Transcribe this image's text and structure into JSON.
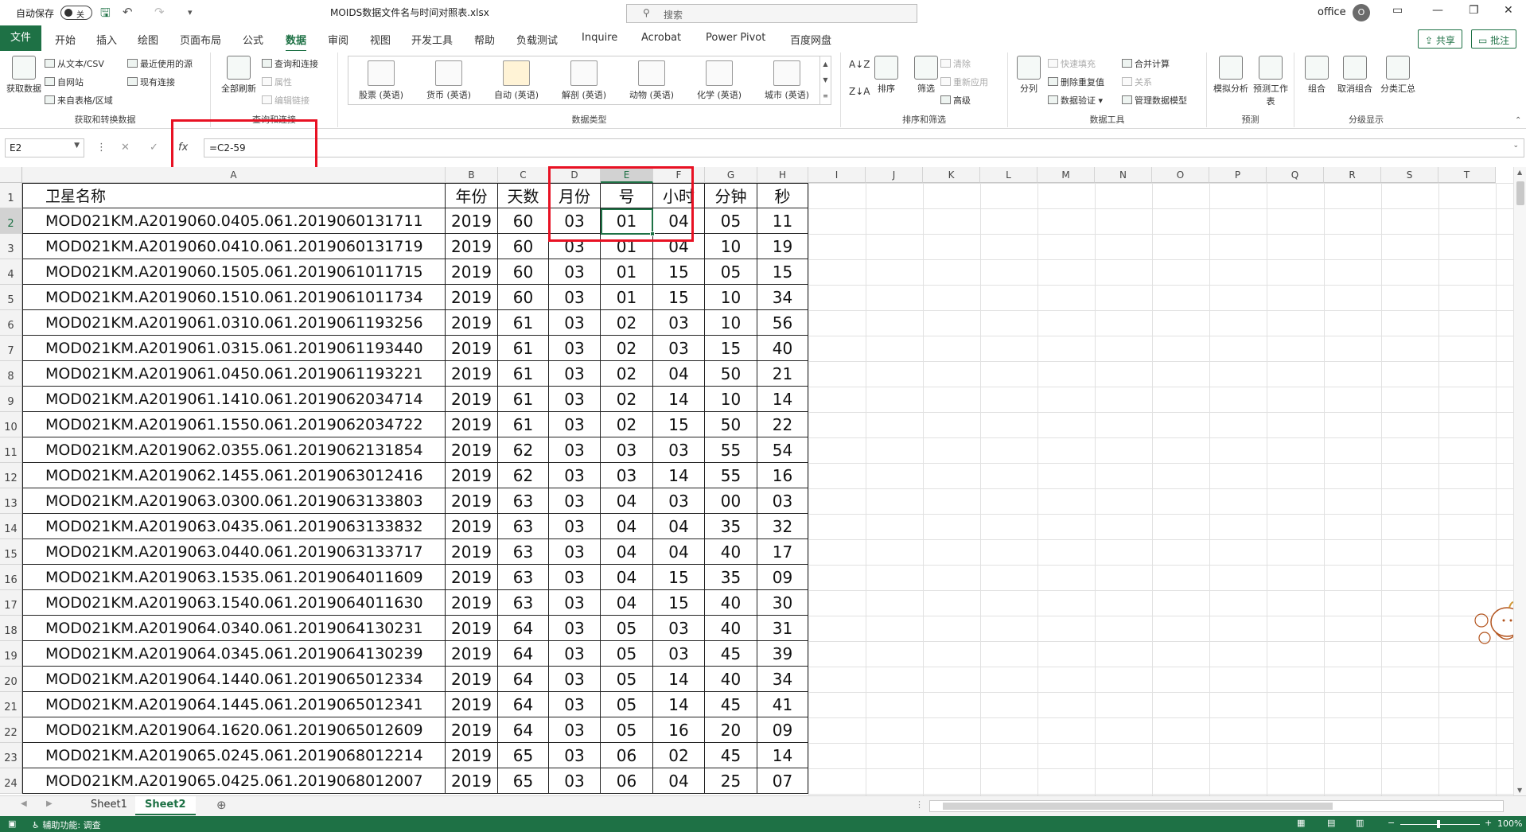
{
  "titlebar": {
    "autosave_label": "自动保存",
    "autosave_state": "关",
    "filename": "MOIDS数据文件名与时间对照表.xlsx",
    "search_placeholder": "搜索",
    "user_name": "office",
    "avatar_initial": "O"
  },
  "tabs": [
    "文件",
    "开始",
    "插入",
    "绘图",
    "页面布局",
    "公式",
    "数据",
    "审阅",
    "视图",
    "开发工具",
    "帮助",
    "负载测试",
    "Inquire",
    "Acrobat",
    "Power Pivot",
    "百度网盘"
  ],
  "active_tab": "数据",
  "share_label": "共享",
  "comment_label": "批注",
  "ribbon": {
    "get_transform": {
      "big": "获取数据",
      "items": [
        "从文本/CSV",
        "自网站",
        "来自表格/区域",
        "最近使用的源",
        "现有连接"
      ],
      "group_label": "获取和转换数据"
    },
    "queries": {
      "big": "全部刷新",
      "items": [
        "查询和连接",
        "属性",
        "编辑链接"
      ],
      "group_label": "查询和连接"
    },
    "data_types": {
      "items": [
        "股票 (英语)",
        "货币 (英语)",
        "自动 (英语)",
        "解剖 (英语)",
        "动物 (英语)",
        "化学 (英语)",
        "城市 (英语)"
      ],
      "group_label": "数据类型"
    },
    "sort_filter": {
      "sort": "排序",
      "filter": "筛选",
      "items": [
        "清除",
        "重新应用",
        "高级"
      ],
      "group_label": "排序和筛选"
    },
    "data_tools": {
      "big": "分列",
      "items": [
        "快速填充",
        "删除重复值",
        "数据验证",
        "合并计算",
        "关系",
        "管理数据模型"
      ],
      "group_label": "数据工具"
    },
    "forecast": {
      "items": [
        "模拟分析",
        "预测工作表"
      ],
      "group_label": "预测"
    },
    "outline": {
      "items": [
        "组合",
        "取消组合",
        "分类汇总"
      ],
      "group_label": "分级显示"
    }
  },
  "formula_bar": {
    "name_box": "E2",
    "formula": "=C2-59"
  },
  "columns": [
    "A",
    "B",
    "C",
    "D",
    "E",
    "F",
    "G",
    "H",
    "I",
    "J",
    "K",
    "L",
    "M",
    "N",
    "O",
    "P",
    "Q",
    "R",
    "S",
    "T"
  ],
  "headers": [
    "卫星名称",
    "年份",
    "天数",
    "月份",
    "号",
    "小时",
    "分钟",
    "秒"
  ],
  "rows": [
    [
      "MOD021KM.A2019060.0405.061.2019060131711",
      "2019",
      "60",
      "03",
      "01",
      "04",
      "05",
      "11"
    ],
    [
      "MOD021KM.A2019060.0410.061.2019060131719",
      "2019",
      "60",
      "03",
      "01",
      "04",
      "10",
      "19"
    ],
    [
      "MOD021KM.A2019060.1505.061.2019061011715",
      "2019",
      "60",
      "03",
      "01",
      "15",
      "05",
      "15"
    ],
    [
      "MOD021KM.A2019060.1510.061.2019061011734",
      "2019",
      "60",
      "03",
      "01",
      "15",
      "10",
      "34"
    ],
    [
      "MOD021KM.A2019061.0310.061.2019061193256",
      "2019",
      "61",
      "03",
      "02",
      "03",
      "10",
      "56"
    ],
    [
      "MOD021KM.A2019061.0315.061.2019061193440",
      "2019",
      "61",
      "03",
      "02",
      "03",
      "15",
      "40"
    ],
    [
      "MOD021KM.A2019061.0450.061.2019061193221",
      "2019",
      "61",
      "03",
      "02",
      "04",
      "50",
      "21"
    ],
    [
      "MOD021KM.A2019061.1410.061.2019062034714",
      "2019",
      "61",
      "03",
      "02",
      "14",
      "10",
      "14"
    ],
    [
      "MOD021KM.A2019061.1550.061.2019062034722",
      "2019",
      "61",
      "03",
      "02",
      "15",
      "50",
      "22"
    ],
    [
      "MOD021KM.A2019062.0355.061.2019062131854",
      "2019",
      "62",
      "03",
      "03",
      "03",
      "55",
      "54"
    ],
    [
      "MOD021KM.A2019062.1455.061.2019063012416",
      "2019",
      "62",
      "03",
      "03",
      "14",
      "55",
      "16"
    ],
    [
      "MOD021KM.A2019063.0300.061.2019063133803",
      "2019",
      "63",
      "03",
      "04",
      "03",
      "00",
      "03"
    ],
    [
      "MOD021KM.A2019063.0435.061.2019063133832",
      "2019",
      "63",
      "03",
      "04",
      "04",
      "35",
      "32"
    ],
    [
      "MOD021KM.A2019063.0440.061.2019063133717",
      "2019",
      "63",
      "03",
      "04",
      "04",
      "40",
      "17"
    ],
    [
      "MOD021KM.A2019063.1535.061.2019064011609",
      "2019",
      "63",
      "03",
      "04",
      "15",
      "35",
      "09"
    ],
    [
      "MOD021KM.A2019063.1540.061.2019064011630",
      "2019",
      "63",
      "03",
      "04",
      "15",
      "40",
      "30"
    ],
    [
      "MOD021KM.A2019064.0340.061.2019064130231",
      "2019",
      "64",
      "03",
      "05",
      "03",
      "40",
      "31"
    ],
    [
      "MOD021KM.A2019064.0345.061.2019064130239",
      "2019",
      "64",
      "03",
      "05",
      "03",
      "45",
      "39"
    ],
    [
      "MOD021KM.A2019064.1440.061.2019065012334",
      "2019",
      "64",
      "03",
      "05",
      "14",
      "40",
      "34"
    ],
    [
      "MOD021KM.A2019064.1445.061.2019065012341",
      "2019",
      "64",
      "03",
      "05",
      "14",
      "45",
      "41"
    ],
    [
      "MOD021KM.A2019064.1620.061.2019065012609",
      "2019",
      "64",
      "03",
      "05",
      "16",
      "20",
      "09"
    ],
    [
      "MOD021KM.A2019065.0245.061.2019068012214",
      "2019",
      "65",
      "03",
      "06",
      "02",
      "45",
      "14"
    ],
    [
      "MOD021KM.A2019065.0425.061.2019068012007",
      "2019",
      "65",
      "03",
      "06",
      "04",
      "25",
      "07"
    ]
  ],
  "sheets": [
    "Sheet1",
    "Sheet2"
  ],
  "active_sheet": "Sheet2",
  "status": {
    "accessibility": "辅助功能: 调查",
    "zoom": "100%"
  },
  "colors": {
    "accent": "#1e7145",
    "highlight_box": "#e81123"
  }
}
